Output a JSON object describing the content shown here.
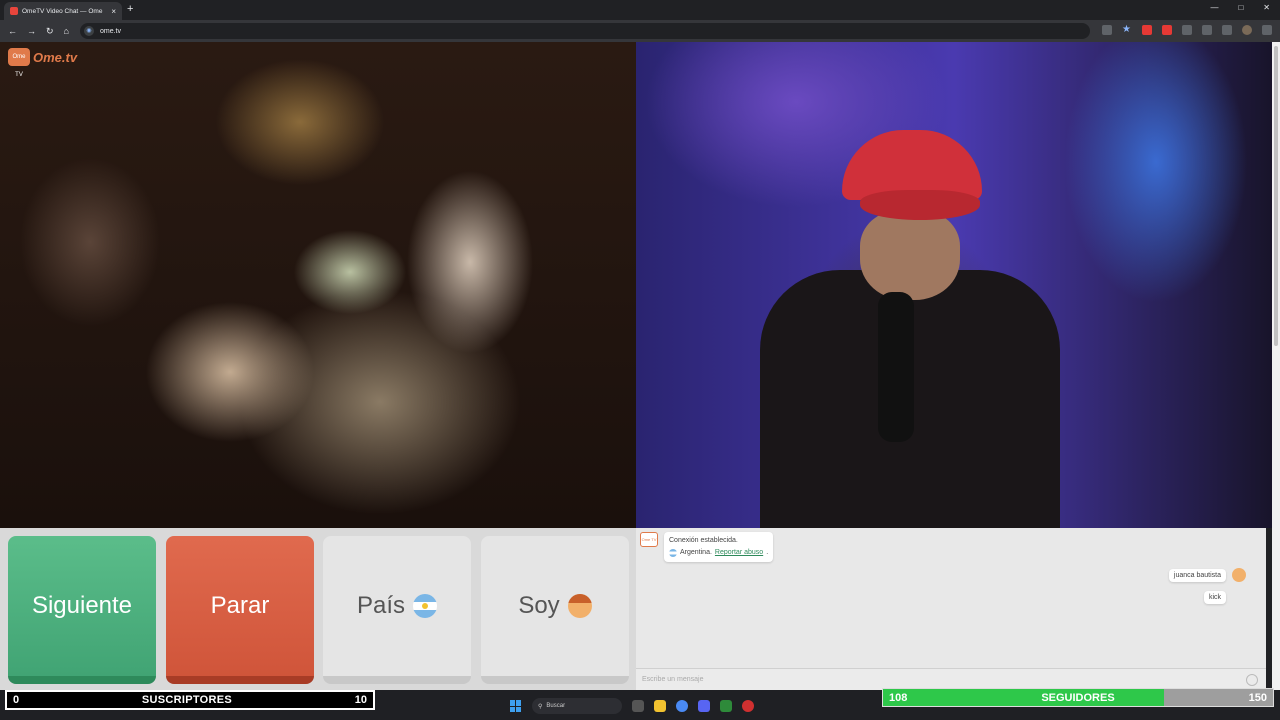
{
  "browser": {
    "tab_title": "OmeTV Video Chat — Ome",
    "url": "ome.tv",
    "new_tab": "+",
    "close_tab": "×"
  },
  "logo": {
    "text": "Ome.tv",
    "badge": "Ome TV"
  },
  "controls": {
    "next_label": "Siguiente",
    "stop_label": "Parar",
    "country_label": "País",
    "me_label": "Soy"
  },
  "chat": {
    "system_line1": "Conexión establecida.",
    "country": "Argentina.",
    "report_link": "Reportar abuso",
    "report_suffix": ".",
    "messages": [
      {
        "text": "juanca bautista"
      },
      {
        "text": "kick"
      }
    ],
    "input_placeholder": "Escribe un mensaje"
  },
  "overlay": {
    "subscribers": {
      "current": "0",
      "label": "SUSCRIPTORES",
      "goal": "10"
    },
    "followers": {
      "current": "108",
      "label": "SEGUIDORES",
      "goal": "150",
      "progress": 0.72
    }
  },
  "taskbar": {
    "search_placeholder": "Buscar"
  },
  "colors": {
    "next_green": "#41a474",
    "stop_red": "#d0553a",
    "followers_green": "#2ec84a",
    "brand_orange": "#e07a4a"
  }
}
